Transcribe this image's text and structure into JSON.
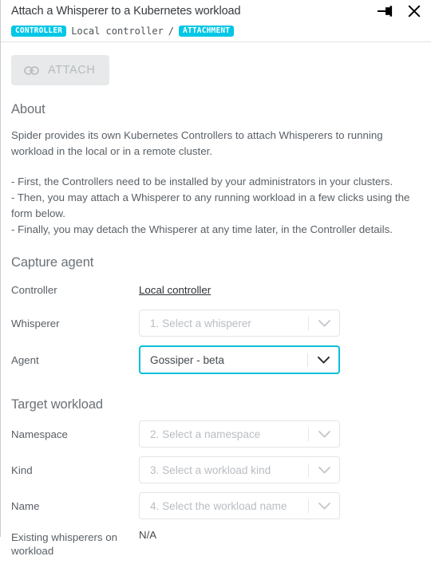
{
  "window": {
    "title": "Attach a Whisperer to a Kubernetes workload",
    "pin_icon": "pin-icon",
    "close_icon": "close-icon"
  },
  "breadcrumb": {
    "controller_chip": "CONTROLLER",
    "controller_name": "Local controller",
    "separator": "/",
    "attachment_chip": "ATTACHMENT"
  },
  "toolbar": {
    "attach_label": "ATTACH",
    "attach_icon": "link-icon",
    "attach_disabled": true
  },
  "about": {
    "heading": "About",
    "paragraph1": "Spider provides its own Kubernetes Controllers to attach Whisperers to running workload in the local or in a remote cluster.",
    "paragraph2": "- First, the Controllers need to be installed by your administrators in your clusters.\n- Then, you may attach a Whisperer to any running workload in a few clicks using the form below.\n- Finally, you may detach the Whisperer at any time later, in the Controller details."
  },
  "capture_agent": {
    "heading": "Capture agent",
    "controller": {
      "label": "Controller",
      "value": "Local controller"
    },
    "whisperer": {
      "label": "Whisperer",
      "placeholder": "1. Select a whisperer",
      "value": ""
    },
    "agent": {
      "label": "Agent",
      "placeholder": "Gossiper - beta",
      "value": "Gossiper - beta"
    }
  },
  "target_workload": {
    "heading": "Target workload",
    "namespace": {
      "label": "Namespace",
      "placeholder": "2. Select a namespace",
      "value": ""
    },
    "kind": {
      "label": "Kind",
      "placeholder": "3. Select a workload kind",
      "value": ""
    },
    "name": {
      "label": "Name",
      "placeholder": "4. Select the workload name",
      "value": ""
    },
    "existing_whisperers": {
      "label": "Existing whisperers on workload",
      "value": "N/A"
    }
  },
  "colors": {
    "accent": "#00c7e6",
    "focus_border": "#0bbfdb",
    "text": "#5a6066",
    "muted": "#b9bdc2"
  }
}
